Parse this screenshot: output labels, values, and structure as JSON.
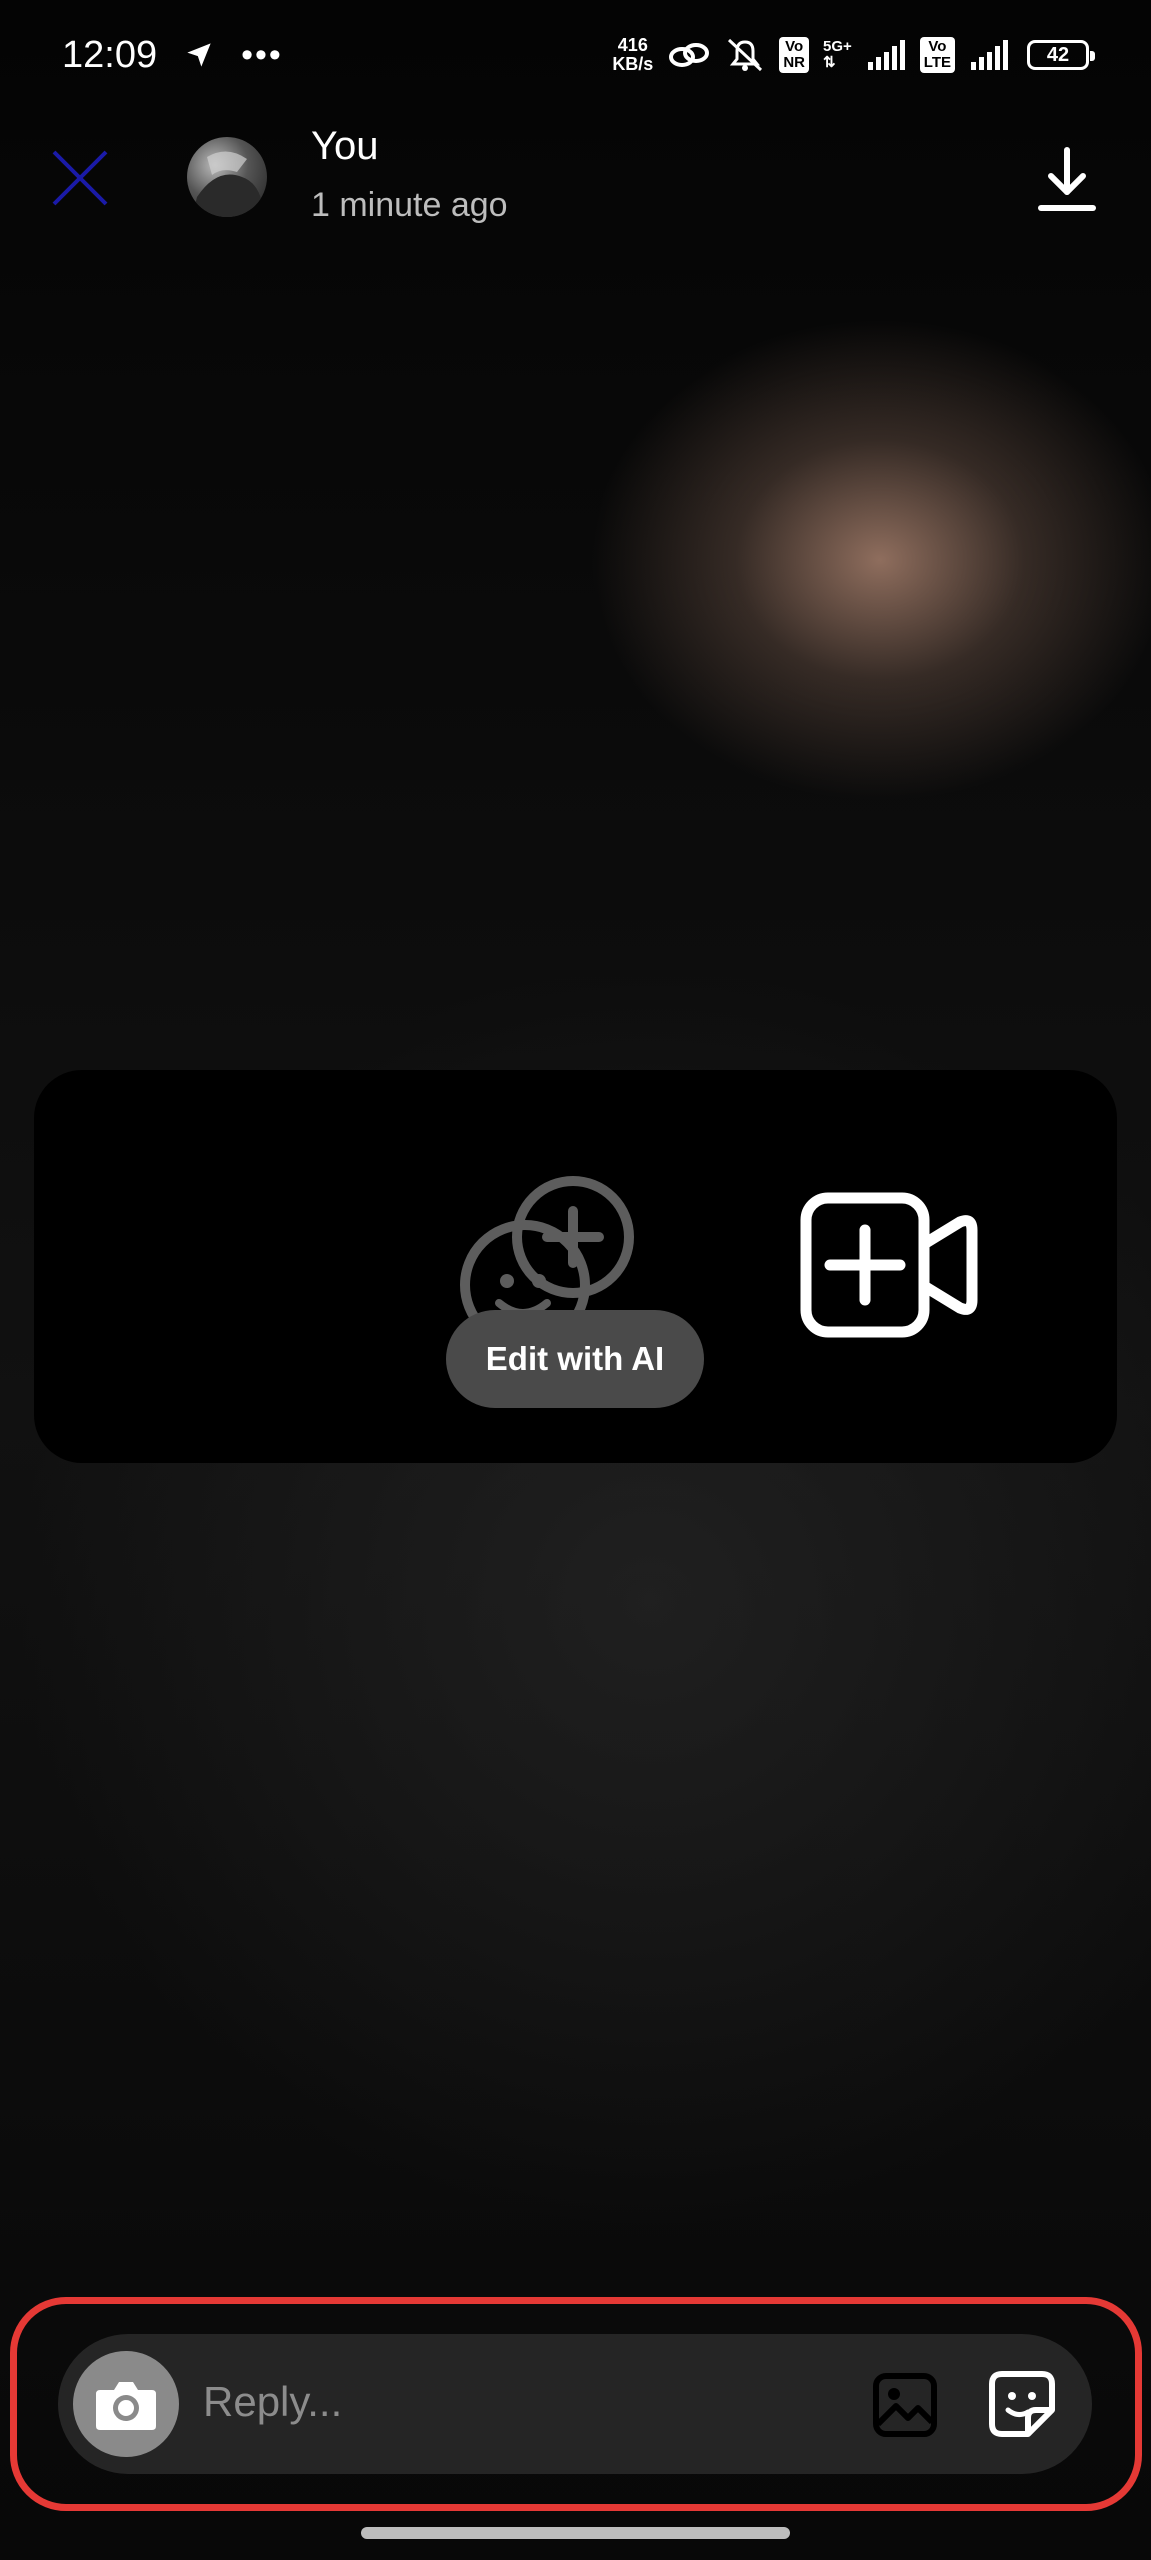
{
  "status_bar": {
    "time": "12:09",
    "net_speed_value": "416",
    "net_speed_unit": "KB/s",
    "volte1_top": "Vo",
    "volte1_bottom": "NR",
    "network_type": "5G+",
    "volte2_top": "Vo",
    "volte2_bottom": "LTE",
    "battery": "42"
  },
  "header": {
    "username": "You",
    "time_ago": "1 minute ago"
  },
  "stickers": {
    "edit_ai_label": "Edit with AI"
  },
  "reply": {
    "placeholder": "Reply..."
  },
  "colors": {
    "close_icon": "#1a1aa8",
    "highlight_border": "#e53935",
    "reply_bar_bg": "#252525"
  }
}
